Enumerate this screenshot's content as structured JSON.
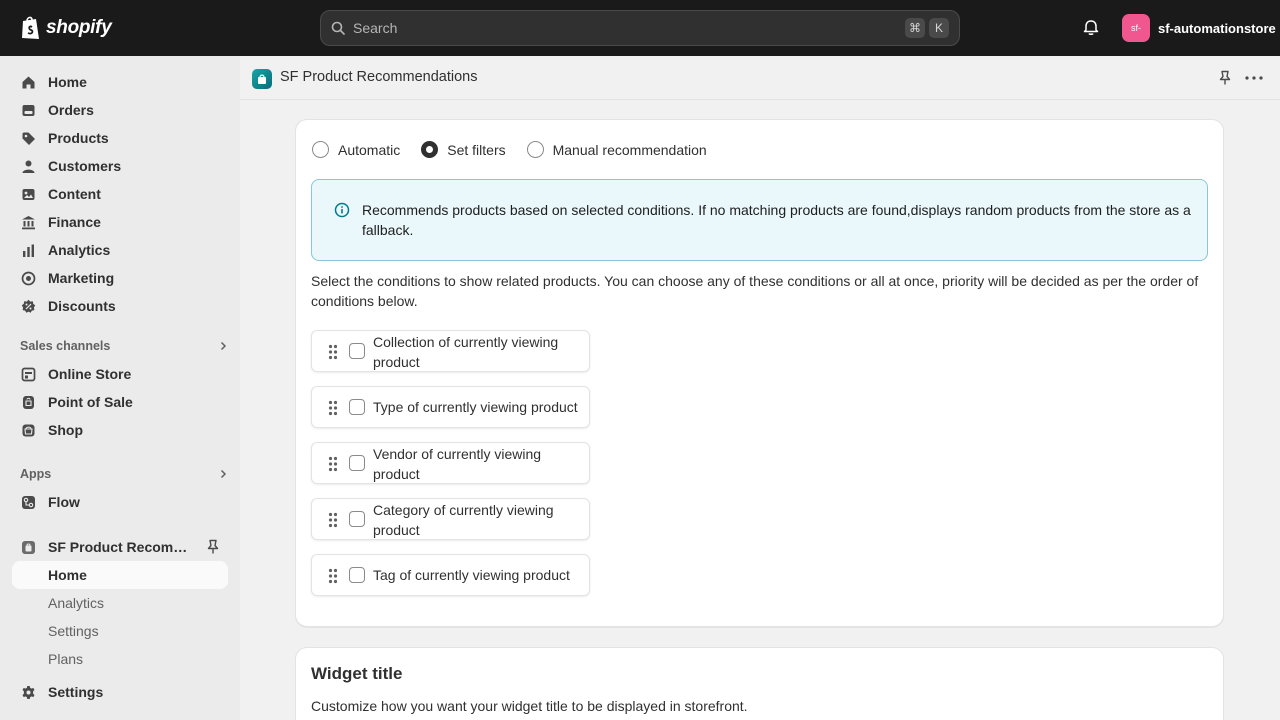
{
  "topbar": {
    "logo_text": "shopify",
    "search_placeholder": "Search",
    "shortcut_key1": "⌘",
    "shortcut_key2": "K",
    "store_avatar": "sf-",
    "store_name": "sf-automationstore"
  },
  "sidebar": {
    "items": [
      {
        "label": "Home",
        "icon": "home-icon"
      },
      {
        "label": "Orders",
        "icon": "orders-icon"
      },
      {
        "label": "Products",
        "icon": "tag-icon"
      },
      {
        "label": "Customers",
        "icon": "person-icon"
      },
      {
        "label": "Content",
        "icon": "content-icon"
      },
      {
        "label": "Finance",
        "icon": "bank-icon"
      },
      {
        "label": "Analytics",
        "icon": "bar-chart-icon"
      },
      {
        "label": "Marketing",
        "icon": "target-icon"
      },
      {
        "label": "Discounts",
        "icon": "discount-icon"
      }
    ],
    "sales_channels_heading": "Sales channels",
    "sales_channels": [
      {
        "label": "Online Store",
        "icon": "store-icon"
      },
      {
        "label": "Point of Sale",
        "icon": "pos-icon"
      },
      {
        "label": "Shop",
        "icon": "shop-bag-icon"
      }
    ],
    "apps_heading": "Apps",
    "apps": [
      {
        "label": "Flow",
        "icon": "flow-icon"
      },
      {
        "label": "SF Product Recomme...",
        "icon": "app-icon"
      }
    ],
    "app_sub": [
      {
        "label": "Home"
      },
      {
        "label": "Analytics"
      },
      {
        "label": "Settings"
      },
      {
        "label": "Plans"
      }
    ],
    "settings_label": "Settings"
  },
  "main": {
    "app_title": "SF Product Recommendations",
    "radio_options": [
      {
        "label": "Automatic",
        "selected": false
      },
      {
        "label": "Set filters",
        "selected": true
      },
      {
        "label": "Manual recommendation",
        "selected": false
      }
    ],
    "banner_text": "Recommends products based on selected conditions. If no matching products are found,displays random products from the store as a fallback.",
    "conditions_description": "Select the conditions to show related products. You can choose any of these conditions or all at once, priority will be decided as per the order of conditions below.",
    "conditions": [
      {
        "label": "Collection of currently viewing product",
        "checked": false
      },
      {
        "label": "Type of currently viewing product",
        "checked": false
      },
      {
        "label": "Vendor of currently viewing product",
        "checked": false
      },
      {
        "label": "Category of currently viewing product",
        "checked": false
      },
      {
        "label": "Tag of currently viewing product",
        "checked": false
      }
    ],
    "widget_title_heading": "Widget title",
    "widget_title_description": "Customize how you want your widget title to be displayed in storefront."
  }
}
